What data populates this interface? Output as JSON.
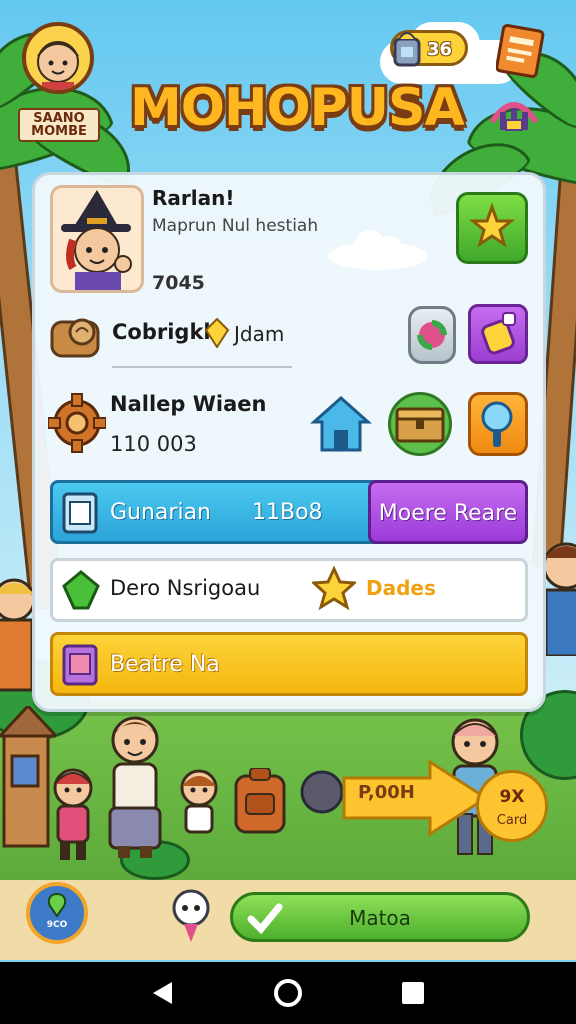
{
  "header": {
    "avatar_label": "SAANO MOMBE",
    "title": "MOHOPUSA",
    "currency_value": "36",
    "book_icon": "book-icon",
    "gate_icon": "gate-icon"
  },
  "profile": {
    "name": "Rarlan!",
    "subtitle": "Maprun Nul hestiah",
    "score": "7045"
  },
  "rows": {
    "row2_label": "Cobrigkl",
    "row2_value": "Jdam",
    "row3_label": "Nallep Wiaen",
    "row3_value": "110 003"
  },
  "bars": {
    "blue_label": "Gunarian",
    "blue_value": "11Bo8",
    "more_label": "Moere Reare",
    "white_label": "Dero Nsrigoau",
    "white_value": "Dades",
    "yellow_label": "Beatre Na"
  },
  "scene": {
    "arrow_value": "P,00H",
    "badge_top": "9X",
    "badge_bottom": "Card"
  },
  "bottom": {
    "map_button_text": "9CO",
    "match_label": "Matoa"
  },
  "colors": {
    "title": "#ffb71f",
    "outline": "#7a3c12",
    "blue_bar": "#2ba4d9",
    "purple_button": "#9b3bd8",
    "yellow_bar": "#f5b70f",
    "green_button": "#4db02c"
  }
}
